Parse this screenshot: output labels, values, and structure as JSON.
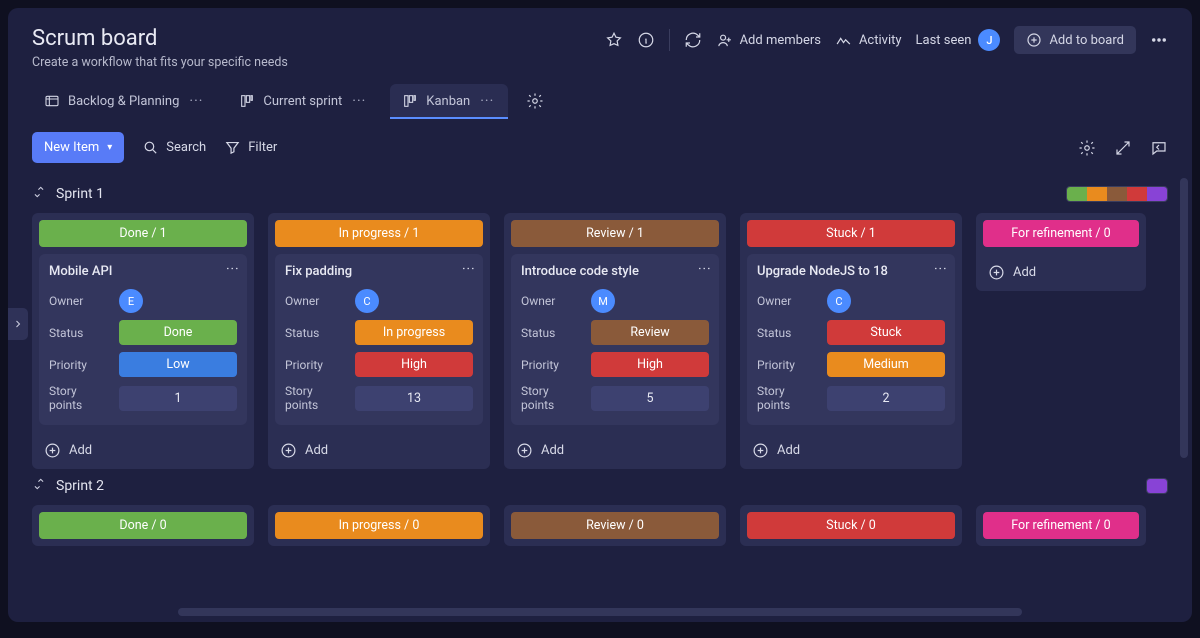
{
  "header": {
    "title": "Scrum board",
    "subtitle": "Create a workflow that fits your specific needs",
    "add_members": "Add members",
    "activity": "Activity",
    "last_seen": "Last seen",
    "avatar": "J",
    "add_to_board": "Add to board"
  },
  "tabs": {
    "t0": "Backlog & Planning",
    "t1": "Current sprint",
    "t2": "Kanban"
  },
  "toolbar": {
    "new_item": "New Item",
    "search": "Search",
    "filter": "Filter"
  },
  "colors": {
    "done": "#6ab04c",
    "inprogress": "#e98b1e",
    "review": "#8a5a3a",
    "stuck": "#d03a3a",
    "refine": "#e02f8a",
    "low": "#3a7de0",
    "high": "#d03a3a",
    "medium": "#e98b1e",
    "purple": "#8843d6"
  },
  "sprints": [
    {
      "name": "Sprint 1",
      "legend": [
        "#6ab04c",
        "#e98b1e",
        "#8a5a3a",
        "#d03a3a",
        "#8843d6"
      ],
      "columns": [
        {
          "label": "Done / 1",
          "color": "#6ab04c",
          "card": {
            "title": "Mobile API",
            "owner": "E",
            "status": {
              "text": "Done",
              "color": "#6ab04c"
            },
            "priority": {
              "text": "Low",
              "color": "#3a7de0"
            },
            "points": "1"
          }
        },
        {
          "label": "In progress / 1",
          "color": "#e98b1e",
          "card": {
            "title": "Fix padding",
            "owner": "C",
            "status": {
              "text": "In progress",
              "color": "#e98b1e"
            },
            "priority": {
              "text": "High",
              "color": "#d03a3a"
            },
            "points": "13"
          }
        },
        {
          "label": "Review / 1",
          "color": "#8a5a3a",
          "card": {
            "title": "Introduce code style",
            "owner": "M",
            "status": {
              "text": "Review",
              "color": "#8a5a3a"
            },
            "priority": {
              "text": "High",
              "color": "#d03a3a"
            },
            "points": "5"
          }
        },
        {
          "label": "Stuck / 1",
          "color": "#d03a3a",
          "card": {
            "title": "Upgrade NodeJS to 18",
            "owner": "C",
            "status": {
              "text": "Stuck",
              "color": "#d03a3a"
            },
            "priority": {
              "text": "Medium",
              "color": "#e98b1e"
            },
            "points": "2"
          }
        },
        {
          "label": "For refinement / 0",
          "color": "#e02f8a",
          "refine": true
        }
      ]
    },
    {
      "name": "Sprint 2",
      "legend": [
        "#8843d6"
      ],
      "columns": [
        {
          "label": "Done / 0",
          "color": "#6ab04c"
        },
        {
          "label": "In progress / 0",
          "color": "#e98b1e"
        },
        {
          "label": "Review / 0",
          "color": "#8a5a3a"
        },
        {
          "label": "Stuck / 0",
          "color": "#d03a3a"
        },
        {
          "label": "For refinement / 0",
          "color": "#e02f8a",
          "refine": true
        }
      ]
    }
  ],
  "labels": {
    "owner": "Owner",
    "status": "Status",
    "priority": "Priority",
    "points": "Story points",
    "add": "Add"
  }
}
